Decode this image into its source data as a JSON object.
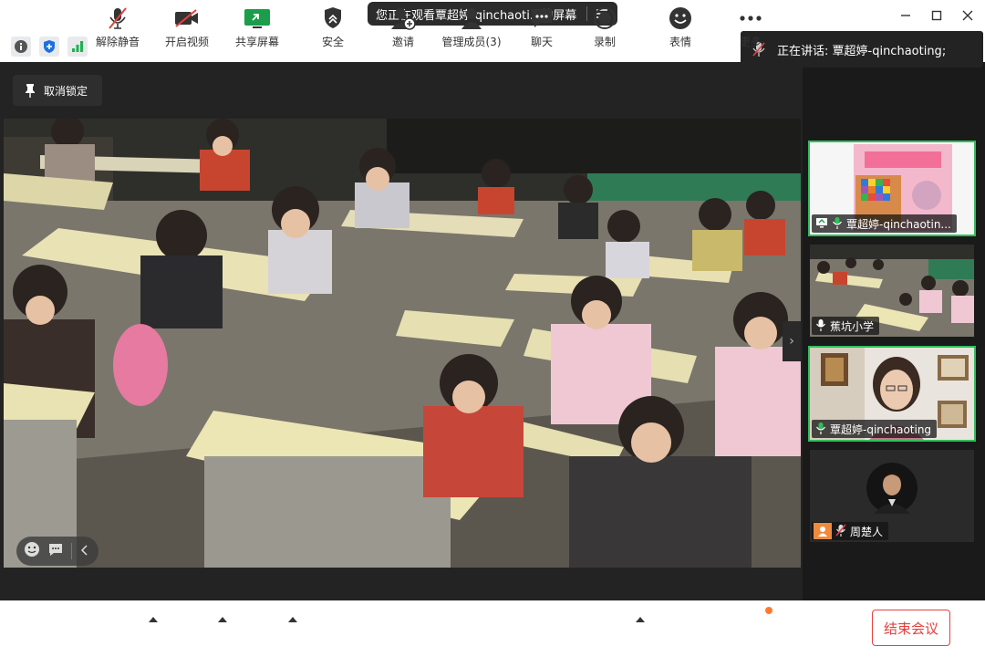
{
  "titlebar": {
    "sharing_text": "您正在观看覃超婷-qinchaoti...的屏幕"
  },
  "main": {
    "unlock_label": "取消锁定"
  },
  "speaking": {
    "text": "正在讲话: 覃超婷-qinchaoting;"
  },
  "participants": [
    {
      "name": "覃超婷-qinchaotin...",
      "kind": "share",
      "active": true
    },
    {
      "name": "蕉坑小学",
      "kind": "classroom",
      "active": false
    },
    {
      "name": "覃超婷-qinchaoting",
      "kind": "teacher",
      "active": true
    },
    {
      "name": "周楚人",
      "kind": "avatar",
      "active": false
    }
  ],
  "toolbar": {
    "mute": "解除静音",
    "video": "开启视频",
    "share": "共享屏幕",
    "security": "安全",
    "invite": "邀请",
    "members": "管理成员(3)",
    "chat": "聊天",
    "record": "录制",
    "reactions": "表情",
    "more": "更多",
    "end": "结束会议"
  },
  "colors": {
    "accent_green": "#2fbf5a",
    "end_red": "#e5413d",
    "share_green": "#1a9e4b"
  }
}
